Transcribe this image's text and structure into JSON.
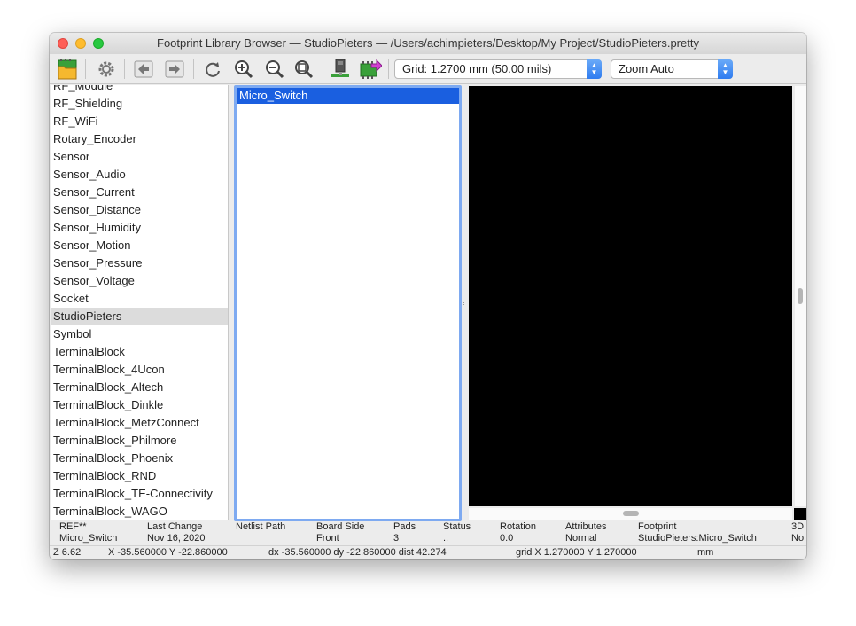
{
  "window": {
    "title": "Footprint Library Browser — StudioPieters — /Users/achimpieters/Desktop/My Project/StudioPieters.pretty"
  },
  "toolbar": {
    "grid_select": "Grid: 1.2700 mm (50.00 mils)",
    "zoom_select": "Zoom Auto",
    "icons": [
      "library-select-icon",
      "preferences-gear-icon",
      "previous-footprint-icon",
      "next-footprint-icon",
      "redraw-icon",
      "zoom-in-icon",
      "zoom-out-icon",
      "zoom-fit-icon",
      "view-3d-icon",
      "insert-footprint-icon"
    ]
  },
  "libraries": {
    "items": [
      "RF_Module",
      "RF_Shielding",
      "RF_WiFi",
      "Rotary_Encoder",
      "Sensor",
      "Sensor_Audio",
      "Sensor_Current",
      "Sensor_Distance",
      "Sensor_Humidity",
      "Sensor_Motion",
      "Sensor_Pressure",
      "Sensor_Voltage",
      "Socket",
      "StudioPieters",
      "Symbol",
      "TerminalBlock",
      "TerminalBlock_4Ucon",
      "TerminalBlock_Altech",
      "TerminalBlock_Dinkle",
      "TerminalBlock_MetzConnect",
      "TerminalBlock_Philmore",
      "TerminalBlock_Phoenix",
      "TerminalBlock_RND",
      "TerminalBlock_TE-Connectivity",
      "TerminalBlock_WAGO"
    ],
    "selected": "StudioPieters"
  },
  "footprints": {
    "items": [
      "Micro_Switch"
    ],
    "selected": "Micro_Switch"
  },
  "info": {
    "columns": [
      {
        "label": "REF**",
        "value": "Micro_Switch"
      },
      {
        "label": "Last Change",
        "value": "Nov 16, 2020"
      },
      {
        "label": "Netlist Path",
        "value": ""
      },
      {
        "label": "Board Side",
        "value": "Front"
      },
      {
        "label": "Pads",
        "value": "3"
      },
      {
        "label": "Status",
        "value": ".."
      },
      {
        "label": "Rotation",
        "value": "0.0"
      },
      {
        "label": "Attributes",
        "value": "Normal"
      },
      {
        "label": "Footprint",
        "value": "StudioPieters:Micro_Switch"
      },
      {
        "label": "3D",
        "value": "No"
      }
    ]
  },
  "status": {
    "zoom": "Z 6.62",
    "xy": "X -35.560000  Y -22.860000",
    "delta": "dx -35.560000  dy -22.860000  dist 42.274",
    "grid": "grid X 1.270000  Y 1.270000",
    "units": "mm"
  }
}
